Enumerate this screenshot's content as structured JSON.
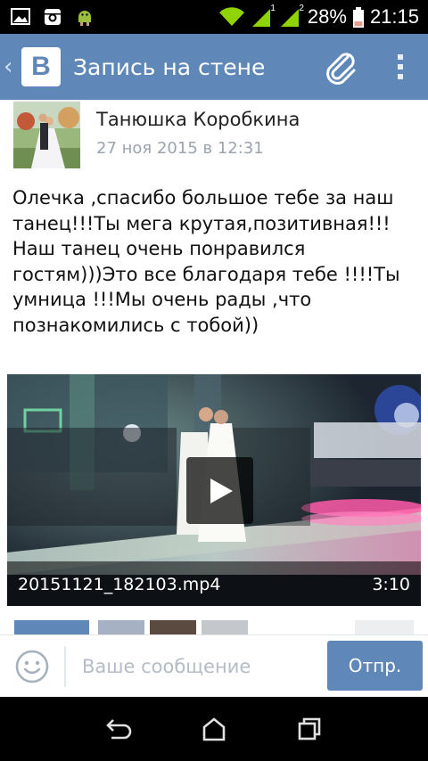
{
  "status_bar": {
    "battery_percent": "28%",
    "time": "21:15",
    "signal_1": "1",
    "signal_2": "2"
  },
  "app_bar": {
    "logo_letter": "В",
    "title": "Запись на стене"
  },
  "post": {
    "author": "Танюшка Коробкина",
    "date": "27 ноя 2015 в 12:31",
    "text": "Олечка ,спасибо большое тебе за наш танец!!!Ты мега крутая,позитивная!!!Наш танец очень понравился гостям)))Это все благодаря тебе !!!!Ты умница !!!Мы очень рады ,что познакомились с тобой))"
  },
  "video": {
    "filename": "20151121_182103.mp4",
    "duration": "3:10"
  },
  "composer": {
    "placeholder": "Ваше сообщение",
    "send_label": "Отпр."
  },
  "colors": {
    "accent": "#5f88b8",
    "status_bar": "#000000",
    "signal_green": "#8fd400",
    "battery_red": "#e0a090"
  },
  "icons": {
    "status_left": [
      "image-icon",
      "instagram-icon",
      "android-icon"
    ],
    "status_right": [
      "wifi-icon",
      "signal-icon",
      "signal-icon",
      "battery-icon"
    ],
    "app_bar": [
      "back-chevron-icon",
      "vk-logo",
      "attachment-icon",
      "more-vertical-icon"
    ],
    "composer": [
      "smile-icon"
    ],
    "nav": [
      "back-icon",
      "home-icon",
      "recent-apps-icon"
    ]
  }
}
